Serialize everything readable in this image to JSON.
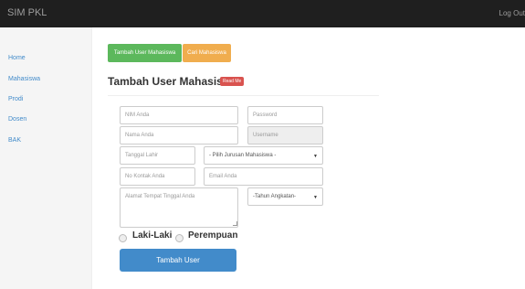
{
  "topbar": {
    "brand": "SIM PKL",
    "logout": "Log Out"
  },
  "sidebar": {
    "items": [
      {
        "label": "Home"
      },
      {
        "label": "Mahasiswa"
      },
      {
        "label": "Prodi"
      },
      {
        "label": "Dosen"
      },
      {
        "label": "BAK"
      }
    ]
  },
  "actions": {
    "add_user": "Tambah User Mahasiswa",
    "search": "Cari Mahasiswa"
  },
  "heading": {
    "title": "Tambah User Mahasiswa",
    "badge": "Read Me"
  },
  "form": {
    "nim": "NIM Anda",
    "password": "Password",
    "nama": "Nama Anda",
    "username": "Username",
    "tanggal_lahir": "Tanggal Lahir",
    "jurusan": "- Pilih Jurusan Mahasiswa -",
    "kontak": "No Kontak Anda",
    "email": "Email Anda",
    "alamat": "Alamat Tempat Tinggal Anda",
    "tahun": "-Tahun Angkatan-",
    "gender_male": "Laki-Laki",
    "gender_female": "Perempuan",
    "submit": "Tambah User"
  }
}
